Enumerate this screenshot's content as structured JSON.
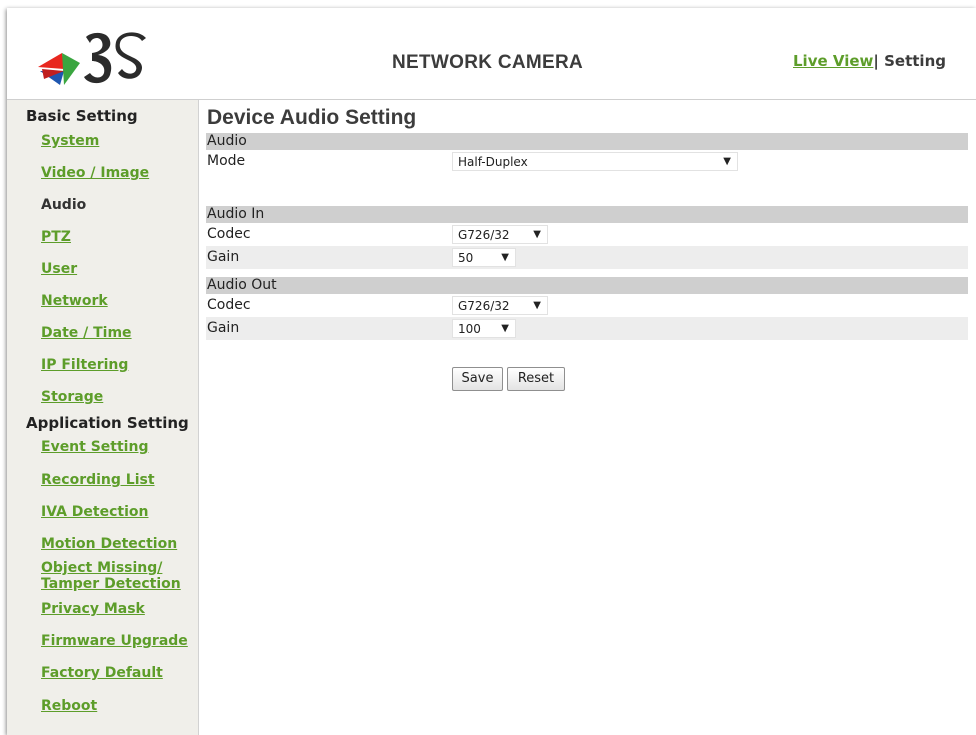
{
  "header": {
    "logo_text": "3S",
    "title": "NETWORK CAMERA",
    "nav": {
      "live_view": "Live View",
      "separator": "|",
      "setting": "Setting"
    }
  },
  "sidebar": {
    "basic_heading": "Basic Setting",
    "basic_items": [
      "System",
      "Video / Image",
      "Audio",
      "PTZ",
      "User",
      "Network",
      "Date / Time",
      "IP Filtering",
      "Storage"
    ],
    "app_heading": "Application Setting",
    "app_items": [
      "Event Setting",
      "Recording List",
      "IVA Detection",
      "Motion Detection",
      "Object Missing/",
      "Tamper Detection",
      "Privacy Mask",
      "Firmware Upgrade",
      "Factory Default",
      "Reboot"
    ],
    "current": "Audio"
  },
  "main": {
    "title": "Device Audio Setting",
    "audio": {
      "section": "Audio",
      "mode_label": "Mode",
      "mode_value": "Half-Duplex"
    },
    "audio_in": {
      "section": "Audio In",
      "codec_label": "Codec",
      "codec_value": "G726/32",
      "gain_label": "Gain",
      "gain_value": "50"
    },
    "audio_out": {
      "section": "Audio Out",
      "codec_label": "Codec",
      "codec_value": "G726/32",
      "gain_label": "Gain",
      "gain_value": "100"
    },
    "buttons": {
      "save": "Save",
      "reset": "Reset"
    }
  },
  "colors": {
    "link_green": "#5d9d2a",
    "section_gray": "#cfcfcf",
    "sidebar_bg": "#f0efea"
  }
}
